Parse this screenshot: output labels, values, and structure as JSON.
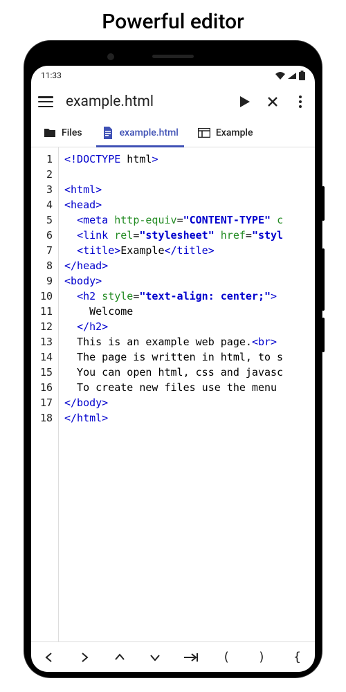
{
  "page_heading": "Powerful editor",
  "status": {
    "time": "11:33"
  },
  "appbar": {
    "title": "example.html"
  },
  "tabs": [
    {
      "label": "Files",
      "active": false
    },
    {
      "label": "example.html",
      "active": true
    },
    {
      "label": "Example",
      "active": false
    }
  ],
  "gutter_lines": [
    "1",
    "2",
    "3",
    "4",
    "5",
    "6",
    "7",
    "8",
    "9",
    "10",
    "11",
    "12",
    "13",
    "14",
    "15",
    "16",
    "17",
    "18"
  ],
  "code_lines": [
    [
      {
        "t": "tag",
        "v": "<!DOCTYPE"
      },
      {
        "t": "p",
        "v": " html"
      },
      {
        "t": "tag",
        "v": ">"
      }
    ],
    [],
    [
      {
        "t": "tag",
        "v": "<html>"
      }
    ],
    [
      {
        "t": "tag",
        "v": "<head>"
      }
    ],
    [
      {
        "t": "p",
        "v": "  "
      },
      {
        "t": "tag",
        "v": "<meta"
      },
      {
        "t": "p",
        "v": " "
      },
      {
        "t": "attr",
        "v": "http-equiv"
      },
      {
        "t": "p",
        "v": "="
      },
      {
        "t": "str",
        "v": "\"CONTENT-TYPE\""
      },
      {
        "t": "p",
        "v": " "
      },
      {
        "t": "attr",
        "v": "c"
      }
    ],
    [
      {
        "t": "p",
        "v": "  "
      },
      {
        "t": "tag",
        "v": "<link"
      },
      {
        "t": "p",
        "v": " "
      },
      {
        "t": "attr",
        "v": "rel"
      },
      {
        "t": "p",
        "v": "="
      },
      {
        "t": "str",
        "v": "\"stylesheet\""
      },
      {
        "t": "p",
        "v": " "
      },
      {
        "t": "attr",
        "v": "href"
      },
      {
        "t": "p",
        "v": "="
      },
      {
        "t": "str",
        "v": "\"styl"
      }
    ],
    [
      {
        "t": "p",
        "v": "  "
      },
      {
        "t": "tag",
        "v": "<title>"
      },
      {
        "t": "p",
        "v": "Example"
      },
      {
        "t": "tag",
        "v": "</title>"
      }
    ],
    [
      {
        "t": "tag",
        "v": "</head>"
      }
    ],
    [
      {
        "t": "tag",
        "v": "<body>"
      }
    ],
    [
      {
        "t": "p",
        "v": "  "
      },
      {
        "t": "tag",
        "v": "<h2"
      },
      {
        "t": "p",
        "v": " "
      },
      {
        "t": "attr",
        "v": "style"
      },
      {
        "t": "p",
        "v": "="
      },
      {
        "t": "str",
        "v": "\"text-align: center;\""
      },
      {
        "t": "tag",
        "v": ">"
      }
    ],
    [
      {
        "t": "p",
        "v": "    Welcome"
      }
    ],
    [
      {
        "t": "p",
        "v": "  "
      },
      {
        "t": "tag",
        "v": "</h2>"
      }
    ],
    [
      {
        "t": "p",
        "v": "  This is an example web page."
      },
      {
        "t": "tag",
        "v": "<br>"
      }
    ],
    [
      {
        "t": "p",
        "v": "  The page is written in html, to s"
      }
    ],
    [
      {
        "t": "p",
        "v": "  You can open html, css and javasc"
      }
    ],
    [
      {
        "t": "p",
        "v": "  To create new files use the menu "
      }
    ],
    [
      {
        "t": "tag",
        "v": "</body>"
      }
    ],
    [
      {
        "t": "tag",
        "v": "</html>"
      }
    ]
  ],
  "bottom_buttons": [
    "<",
    ">",
    "^",
    "v",
    "tab",
    "(",
    ")",
    "{"
  ]
}
